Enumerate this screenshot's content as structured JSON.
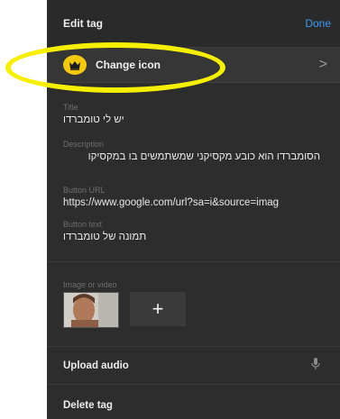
{
  "header": {
    "title": "Edit tag",
    "done_label": "Done"
  },
  "change_icon": {
    "label": "Change icon",
    "icon": "crown-icon",
    "chevron": ">"
  },
  "fields": {
    "title": {
      "label": "Title",
      "value": "יש לי טומברדו"
    },
    "description": {
      "label": "Description",
      "value": "הסומברדו הוא כובע מקסיקני שמשתמשים בו במקסיקו"
    },
    "button_url": {
      "label": "Button URL",
      "value": "https://www.google.com/url?sa=i&source=imag"
    },
    "button_text": {
      "label": "Button text",
      "value": "תמונה של טומברדו"
    }
  },
  "media": {
    "label": "Image or video",
    "add_symbol": "+"
  },
  "upload_audio": {
    "label": "Upload audio",
    "icon": "microphone-icon"
  },
  "delete_tag": {
    "label": "Delete tag"
  },
  "colors": {
    "panel_bg": "#2d2d2d",
    "accent": "#3b9cf5",
    "badge": "#f3c90f",
    "highlight": "#f6ef00"
  }
}
